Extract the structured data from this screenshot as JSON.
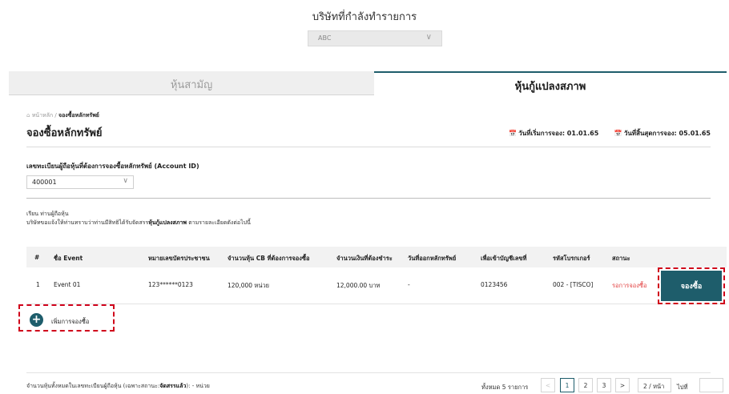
{
  "header": {
    "company_title": "บริษัทที่กำลังทำรายการ",
    "company_value": "ABC"
  },
  "tabs": [
    {
      "label": "หุ้นสามัญ",
      "active": false
    },
    {
      "label": "หุ้นกู้แปลงสภาพ",
      "active": true
    }
  ],
  "breadcrumb": {
    "home": "หน้าหลัก",
    "separator": "/",
    "current": "จองซื้อหลักทรัพย์"
  },
  "page": {
    "title": "จองซื้อหลักทรัพย์",
    "start_date": "วันที่เริ่มการจอง: 01.01.65",
    "end_date": "วันที่สิ้นสุดการจอง: 05.01.65"
  },
  "account": {
    "label": "เลขทะเบียนผู้ถือหุ้นที่ต้องการจองซื้อหลักทรัพย์ (Account ID)",
    "value": "400001"
  },
  "greeting": {
    "line1": "เรียน ท่านผู้ถือหุ้น",
    "line2_prefix": "บริษัทขอแจ้งให้ท่านทราบว่าท่านมีสิทธิได้รับจัดสรร",
    "line2_bold": "หุ้นกู้แปลงสภาพ",
    "line2_suffix": " ตามรายละเอียดดังต่อไปนี้"
  },
  "table": {
    "headers": [
      "#",
      "ชื่อ Event",
      "หมายเลขบัตรประชาชน",
      "จำนวนหุ้น CB ที่ต้องการจองซื้อ",
      "จำนวนเงินที่ต้องชำระ",
      "วันที่ออกหลักทรัพย์",
      "เพื่อเข้าบัญชีเลขที่",
      "รหัสโบรกเกอร์",
      "สถานะ"
    ],
    "rows": [
      [
        "1",
        "Event 01",
        "123******0123",
        "120,000 หน่วย",
        "12,000.00 บาท",
        "-",
        "0123456",
        "002 - [TISCO]",
        "รอการจองซื้อ"
      ]
    ],
    "book_button": "จองซื้อ"
  },
  "add_booking": {
    "icon": "plus-icon",
    "label": "เพิ่มการจองซื้อ"
  },
  "footer": {
    "note_prefix": "จำนวนหุ้นทั้งหมดในเลขทะเบียนผู้ถือหุ้น (เฉพาะสถานะ:",
    "note_bold": "จัดสรรแล้ว",
    "note_suffix": "): - หน่วย",
    "total": "ทั้งหมด 5 รายการ",
    "pages": [
      "1",
      "2",
      "3"
    ],
    "current_page": "1",
    "prev": "<",
    "next": ">",
    "per_page": "2 / หน้า",
    "goto_label": "ไปที่"
  },
  "colors": {
    "accent": "#1e5d6b",
    "status_pending": "#e24040",
    "highlight_box": "#d0021b"
  }
}
